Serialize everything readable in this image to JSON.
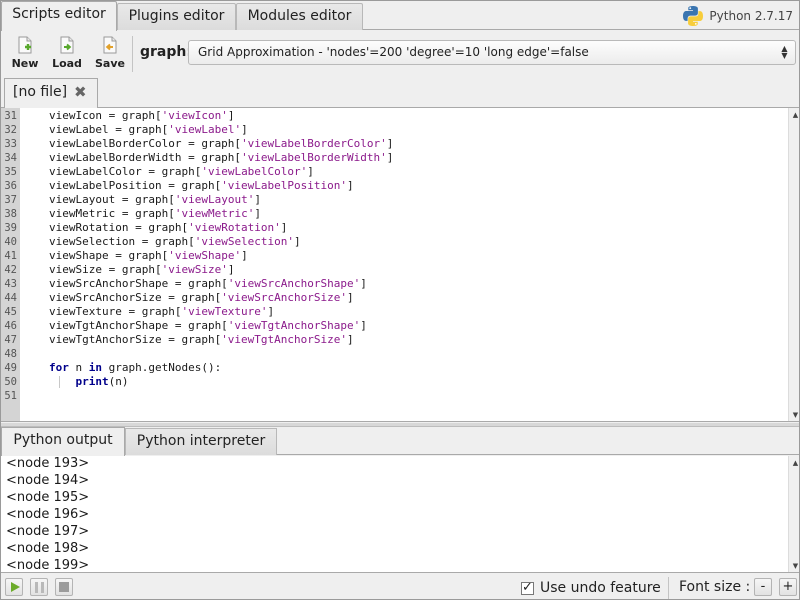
{
  "top_tabs": [
    {
      "label": "Scripts editor"
    },
    {
      "label": "Plugins editor"
    },
    {
      "label": "Modules editor"
    }
  ],
  "python_version": "Python 2.7.17",
  "toolbar": {
    "new_label": "New",
    "load_label": "Load",
    "save_label": "Save",
    "graph_label": "graph:",
    "graph_value": "Grid Approximation - 'nodes'=200 'degree'=10 'long edge'=false"
  },
  "file_tab": {
    "label": "[no file]",
    "close_icon": "✖"
  },
  "editor": {
    "lines": [
      {
        "n": "31",
        "pre": "viewIcon = graph[",
        "str": "'viewIcon'",
        "post": "]"
      },
      {
        "n": "32",
        "pre": "viewLabel = graph[",
        "str": "'viewLabel'",
        "post": "]"
      },
      {
        "n": "33",
        "pre": "viewLabelBorderColor = graph[",
        "str": "'viewLabelBorderColor'",
        "post": "]"
      },
      {
        "n": "34",
        "pre": "viewLabelBorderWidth = graph[",
        "str": "'viewLabelBorderWidth'",
        "post": "]"
      },
      {
        "n": "35",
        "pre": "viewLabelColor = graph[",
        "str": "'viewLabelColor'",
        "post": "]"
      },
      {
        "n": "36",
        "pre": "viewLabelPosition = graph[",
        "str": "'viewLabelPosition'",
        "post": "]"
      },
      {
        "n": "37",
        "pre": "viewLayout = graph[",
        "str": "'viewLayout'",
        "post": "]"
      },
      {
        "n": "38",
        "pre": "viewMetric = graph[",
        "str": "'viewMetric'",
        "post": "]"
      },
      {
        "n": "39",
        "pre": "viewRotation = graph[",
        "str": "'viewRotation'",
        "post": "]"
      },
      {
        "n": "40",
        "pre": "viewSelection = graph[",
        "str": "'viewSelection'",
        "post": "]"
      },
      {
        "n": "41",
        "pre": "viewShape = graph[",
        "str": "'viewShape'",
        "post": "]"
      },
      {
        "n": "42",
        "pre": "viewSize = graph[",
        "str": "'viewSize'",
        "post": "]"
      },
      {
        "n": "43",
        "pre": "viewSrcAnchorShape = graph[",
        "str": "'viewSrcAnchorShape'",
        "post": "]"
      },
      {
        "n": "44",
        "pre": "viewSrcAnchorSize = graph[",
        "str": "'viewSrcAnchorSize'",
        "post": "]"
      },
      {
        "n": "45",
        "pre": "viewTexture = graph[",
        "str": "'viewTexture'",
        "post": "]"
      },
      {
        "n": "46",
        "pre": "viewTgtAnchorShape = graph[",
        "str": "'viewTgtAnchorShape'",
        "post": "]"
      },
      {
        "n": "47",
        "pre": "viewTgtAnchorSize = graph[",
        "str": "'viewTgtAnchorSize'",
        "post": "]"
      },
      {
        "n": "48",
        "pre": "",
        "str": "",
        "post": ""
      },
      {
        "n": "49",
        "kw1": "for",
        "mid1": " n ",
        "kw2": "in",
        "rest": " graph.getNodes():"
      },
      {
        "n": "50",
        "indent": "    ",
        "kw1": "print",
        "rest": "(n)"
      },
      {
        "n": "51",
        "pre": "",
        "str": "",
        "post": ""
      }
    ]
  },
  "bottom_tabs": [
    {
      "label": "Python output"
    },
    {
      "label": "Python interpreter"
    }
  ],
  "output_lines": [
    "<node 193>",
    "<node 194>",
    "<node 195>",
    "<node 196>",
    "<node 197>",
    "<node 198>",
    "<node 199>"
  ],
  "status": {
    "undo_label": "Use undo feature",
    "undo_checked": true,
    "font_size_label": "Font size :",
    "minus_label": "-",
    "plus_label": "+"
  },
  "icons": {
    "new": "new-file-icon",
    "load": "load-file-icon",
    "save": "save-file-icon",
    "python": "python-logo-icon",
    "play": "play-icon",
    "pause": "pause-icon",
    "stop": "stop-icon"
  }
}
